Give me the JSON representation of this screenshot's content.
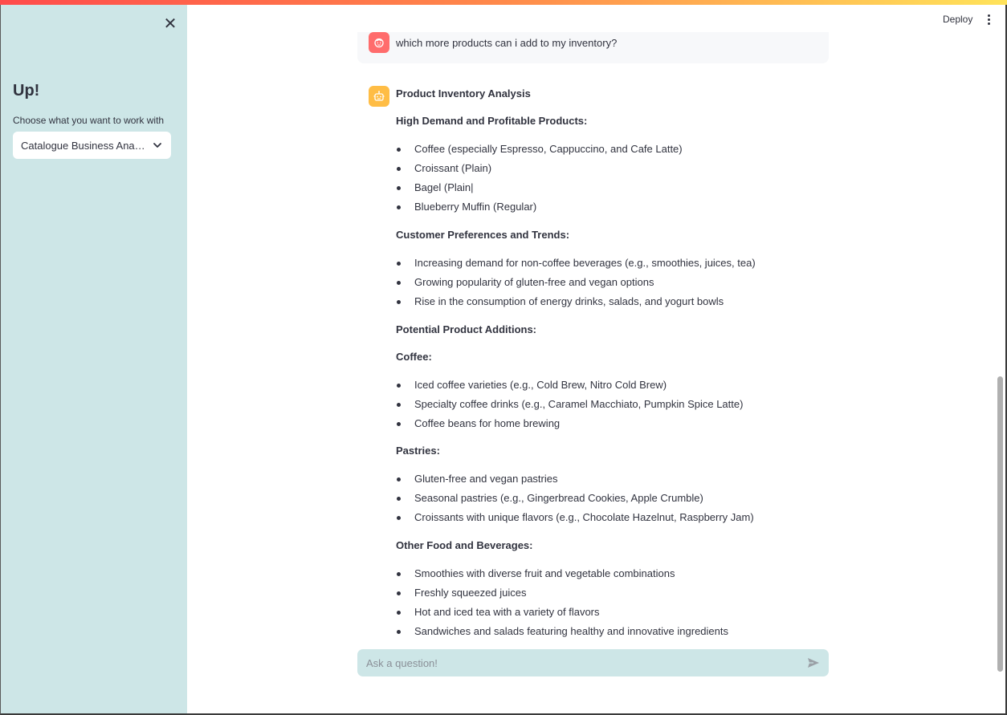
{
  "sidebar": {
    "close_glyph": "✕",
    "title": "Up!",
    "select_label": "Choose what you want to work with",
    "select_value": "Catalogue Business Analysis"
  },
  "header": {
    "deploy_label": "Deploy"
  },
  "user_message": {
    "text": "which more products can i add to my inventory?"
  },
  "assistant": {
    "title": "Product Inventory Analysis",
    "sections": [
      {
        "heading": "High Demand and Profitable Products:",
        "items": [
          "Coffee (especially Espresso, Cappuccino, and Cafe Latte)",
          "Croissant (Plain)",
          "Bagel (Plain|",
          "Blueberry Muffin (Regular)"
        ]
      },
      {
        "heading": "Customer Preferences and Trends:",
        "items": [
          "Increasing demand for non-coffee beverages (e.g., smoothies, juices, tea)",
          "Growing popularity of gluten-free and vegan options",
          "Rise in the consumption of energy drinks, salads, and yogurt bowls"
        ]
      },
      {
        "heading": "Potential Product Additions:",
        "items": []
      },
      {
        "heading": "Coffee:",
        "items": [
          "Iced coffee varieties (e.g., Cold Brew, Nitro Cold Brew)",
          "Specialty coffee drinks (e.g., Caramel Macchiato, Pumpkin Spice Latte)",
          "Coffee beans for home brewing"
        ]
      },
      {
        "heading": "Pastries:",
        "items": [
          "Gluten-free and vegan pastries",
          "Seasonal pastries (e.g., Gingerbread Cookies, Apple Crumble)",
          "Croissants with unique flavors (e.g., Chocolate Hazelnut, Raspberry Jam)"
        ]
      },
      {
        "heading": "Other Food and Beverages:",
        "items": [
          "Smoothies with diverse fruit and vegetable combinations",
          "Freshly squeezed juices",
          "Hot and iced tea with a variety of flavors",
          "Sandwiches and salads featuring healthy and innovative ingredients"
        ]
      }
    ]
  },
  "chat_input": {
    "placeholder": "Ask a question!"
  },
  "colors": {
    "sidebar_bg": "#cde6e7",
    "user_avatar": "#ff6c6c",
    "bot_avatar": "#ffbd45",
    "text": "#31333f"
  },
  "icons": {
    "close": "close-icon",
    "dropdown": "chevron-down-icon",
    "menu": "kebab-menu-icon",
    "user_avatar": "user-face-icon",
    "bot_avatar": "robot-face-icon",
    "send": "send-icon"
  }
}
